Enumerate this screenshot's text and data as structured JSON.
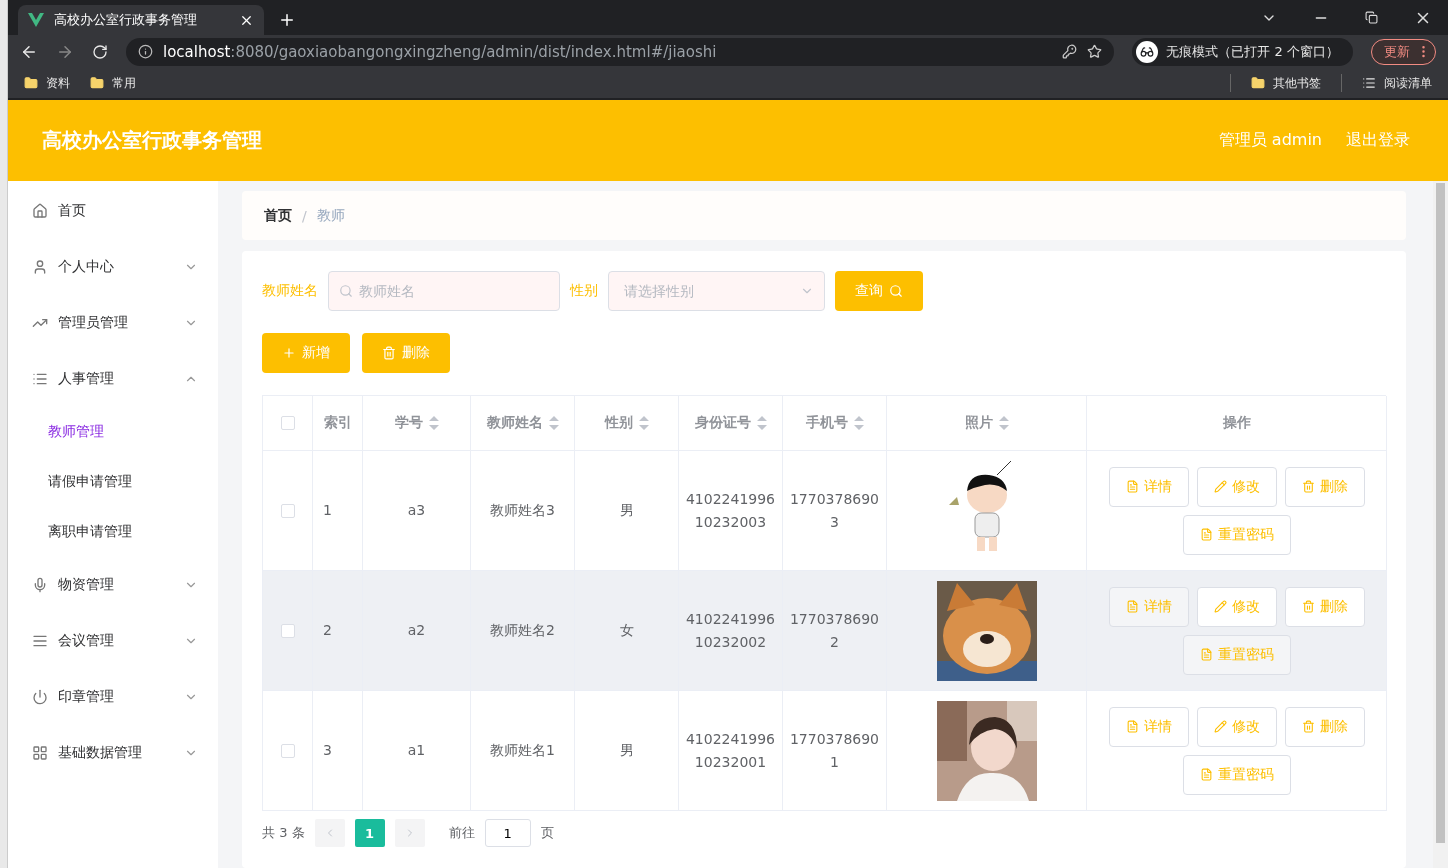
{
  "browser": {
    "tab_title": "高校办公室行政事务管理",
    "url_host": "localhost",
    "url_rest": ":8080/gaoxiaobangongxingzheng/admin/dist/index.html#/jiaoshi",
    "profile": "无痕模式（已打开 2 个窗口）",
    "update_button": "更新",
    "bookmarks": [
      "资料",
      "常用"
    ],
    "other_bookmarks": "其他书签",
    "reading_list": "阅读清单"
  },
  "header": {
    "title": "高校办公室行政事务管理",
    "user": "管理员 admin",
    "logout": "退出登录"
  },
  "sidebar": {
    "items": [
      {
        "label": "首页"
      },
      {
        "label": "个人中心",
        "expanded": false
      },
      {
        "label": "管理员管理",
        "expanded": false
      },
      {
        "label": "人事管理",
        "expanded": true,
        "children": [
          {
            "label": "教师管理",
            "selected": true
          },
          {
            "label": "请假申请管理",
            "selected": false
          },
          {
            "label": "离职申请管理",
            "selected": false
          }
        ]
      },
      {
        "label": "物资管理",
        "expanded": false
      },
      {
        "label": "会议管理",
        "expanded": false
      },
      {
        "label": "印章管理",
        "expanded": false
      },
      {
        "label": "基础数据管理",
        "expanded": false
      }
    ]
  },
  "breadcrumb": [
    "首页",
    "教师"
  ],
  "breadcrumb_separator": "/",
  "search": {
    "name_label": "教师姓名",
    "name_placeholder": "教师姓名",
    "gender_label": "性别",
    "gender_placeholder": "请选择性别",
    "query_button": "查询"
  },
  "actions": [
    "新增",
    "删除"
  ],
  "table": {
    "header_checked": false,
    "columns": [
      {
        "label": "索引",
        "sortable": false
      },
      {
        "label": "学号",
        "sortable": true
      },
      {
        "label": "教师姓名",
        "sortable": true
      },
      {
        "label": "性别",
        "sortable": true
      },
      {
        "label": "身份证号",
        "sortable": true
      },
      {
        "label": "手机号",
        "sortable": true
      },
      {
        "label": "照片",
        "sortable": true
      },
      {
        "label": "操作",
        "sortable": false
      }
    ],
    "rows": [
      {
        "checked": false,
        "hovered": false,
        "index": "1",
        "number": "a3",
        "name": "教师姓名3",
        "gender": "男",
        "id_card": "410224199610232003",
        "phone": "17703786903",
        "buttons": [
          "详情",
          "修改",
          "删除",
          "重置密码"
        ]
      },
      {
        "checked": false,
        "hovered": true,
        "index": "2",
        "number": "a2",
        "name": "教师姓名2",
        "gender": "女",
        "id_card": "410224199610232002",
        "phone": "17703786902",
        "buttons": [
          "详情",
          "修改",
          "删除",
          "重置密码"
        ]
      },
      {
        "checked": false,
        "hovered": false,
        "index": "3",
        "number": "a1",
        "name": "教师姓名1",
        "gender": "男",
        "id_card": "410224199610232001",
        "phone": "17703786901",
        "buttons": [
          "详情",
          "修改",
          "删除",
          "重置密码"
        ]
      }
    ]
  },
  "pagination": {
    "total": "共 3 条",
    "pages": [
      {
        "label": "1",
        "selected": true
      }
    ],
    "goto_label": "前往",
    "goto_value": "1",
    "goto_suffix": "页"
  }
}
